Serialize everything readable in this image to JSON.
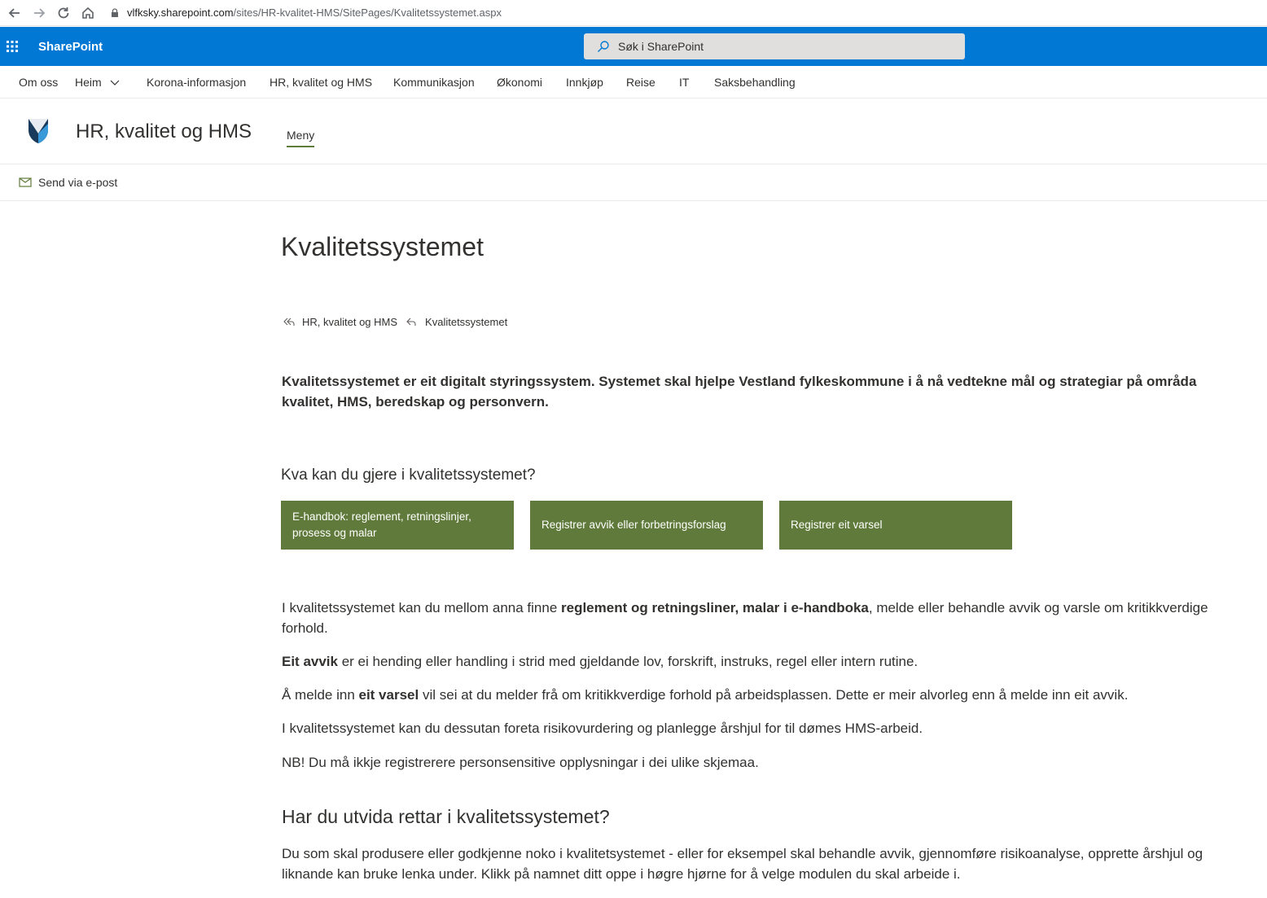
{
  "browser": {
    "url_host": "vlfksky.sharepoint.com",
    "url_path": "/sites/HR-kvalitet-HMS/SitePages/Kvalitetssystemet.aspx"
  },
  "suite": {
    "title": "SharePoint",
    "search_placeholder": "Søk i SharePoint",
    "accent": "#0078d4"
  },
  "hub_nav": {
    "items": [
      {
        "label": "Om oss"
      },
      {
        "label": "Heim"
      },
      {
        "label": "Korona-informasjon"
      },
      {
        "label": "HR, kvalitet og HMS"
      },
      {
        "label": "Kommunikasjon"
      },
      {
        "label": "Økonomi"
      },
      {
        "label": "Innkjøp"
      },
      {
        "label": "Reise"
      },
      {
        "label": "IT"
      },
      {
        "label": "Saksbehandling"
      }
    ]
  },
  "site": {
    "title": "HR, kvalitet og HMS",
    "nav_item": "Meny"
  },
  "command_bar": {
    "send_email": "Send via e-post"
  },
  "page": {
    "title": "Kvalitetssystemet",
    "breadcrumb": [
      "HR, kvalitet og HMS",
      "Kvalitetssystemet"
    ],
    "intro": "Kvalitetssystemet er eit digitalt styringssystem. Systemet skal hjelpe Vestland fylkeskommune i å nå vedtekne mål og strategiar på områda kvalitet, HMS, beredskap og personvern.",
    "section1_heading": "Kva kan du gjere i kvalitetssystemet?",
    "buttons": [
      {
        "label": "E-handbok: reglement, retningslinjer, prosess og malar"
      },
      {
        "label": "Registrer avvik eller forbetringsforslag"
      },
      {
        "label": "Registrer eit varsel"
      }
    ],
    "button_color": "#5f7a3a",
    "p1_a": "I kvalitetssystemet kan du mellom anna finne ",
    "p1_b": "reglement og retningsliner, malar i e-handboka",
    "p1_c": ", melde eller behandle avvik og varsle om kritikkverdige forhold.",
    "p2_a": "Eit avvik",
    "p2_b": " er ei hending eller handling i strid med gjeldande lov, forskrift, instruks, regel eller intern rutine.",
    "p3_a": "Å melde inn ",
    "p3_b": "eit varsel",
    "p3_c": " vil sei at du melder frå om kritikkverdige forhold på arbeidsplassen. Dette er meir alvorleg enn å melde inn eit avvik.",
    "p4": "I kvalitetssystemet kan du dessutan foreta risikovurdering og planlegge årshjul for til dømes HMS-arbeid.",
    "p5": "NB! Du må ikkje registrerere personsensitive opplysningar i dei ulike skjemaa.",
    "section2_heading": "Har du utvida rettar i kvalitetssystemet?",
    "p6": "Du som skal produsere eller godkjenne noko i kvalitetsystemet - eller for eksempel skal behandle avvik, gjennomføre risikoanalyse, opprette årshjul og liknande kan bruke lenka under. Klikk på namnet ditt oppe i høgre hjørne for å velge modulen du skal arbeide i."
  }
}
